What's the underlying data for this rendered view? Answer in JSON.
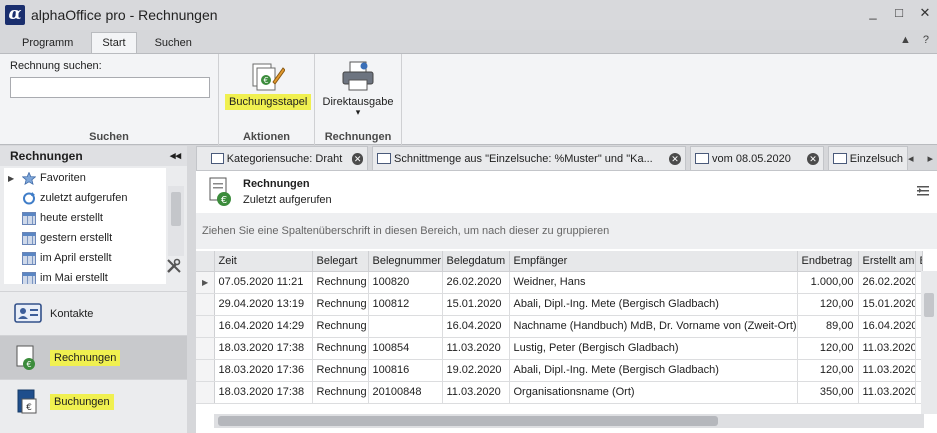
{
  "app": {
    "title": "alphaOffice pro - Rechnungen",
    "logo_glyph": "α",
    "controls": [
      "_",
      "□",
      "✕"
    ]
  },
  "ribbon_tabs": {
    "items": [
      "Programm",
      "Start",
      "Suchen"
    ],
    "active": "Start",
    "right_icons": [
      "▲",
      "?"
    ]
  },
  "ribbon": {
    "search": {
      "label": "Rechnung suchen:",
      "value": "",
      "placeholder": ""
    },
    "groups": {
      "suchen": "Suchen",
      "aktionen": "Aktionen",
      "rechnungen": "Rechnungen"
    },
    "buttons": {
      "buchungsstapel": "Buchungsstapel",
      "direktausgabe": "Direktausgabe",
      "direktausgabe_arrow": "▾"
    }
  },
  "left_panel": {
    "title": "Rechnungen",
    "collapse_glyph": "◂◂",
    "tree": [
      {
        "label": "Favoriten",
        "icon": "star-icon",
        "expander": "▶"
      },
      {
        "label": "zuletzt aufgerufen",
        "icon": "refresh-icon"
      },
      {
        "label": "heute erstellt",
        "icon": "grid-icon"
      },
      {
        "label": "gestern erstellt",
        "icon": "grid-icon"
      },
      {
        "label": "im April erstellt",
        "icon": "grid-icon"
      },
      {
        "label": "im Mai erstellt",
        "icon": "grid-icon"
      }
    ],
    "nav": [
      {
        "label": "Kontakte",
        "icon": "contacts-icon",
        "selected": false
      },
      {
        "label": "Rechnungen",
        "icon": "invoice-icon",
        "selected": true
      },
      {
        "label": "Buchungen",
        "icon": "booking-icon",
        "selected": false
      }
    ]
  },
  "doc_tabs": [
    {
      "label": "Kategoriensuche: Draht",
      "close": "✕"
    },
    {
      "label": "Schnittmenge aus \"Einzelsuche: %Muster\" und \"Ka...",
      "close": "✕"
    },
    {
      "label": "vom 08.05.2020",
      "close": "✕"
    },
    {
      "label": "Einzelsuch",
      "close": ""
    }
  ],
  "tab_arrows": [
    "◂",
    "▸"
  ],
  "content": {
    "title": "Rechnungen",
    "subtitle": "Zuletzt aufgerufen",
    "group_hint": "Ziehen Sie eine Spaltenüberschrift in diesen Bereich, um nach dieser zu gruppieren",
    "row_indicator": "▶",
    "columns": [
      "Zeit",
      "Belegart",
      "Belegnummer",
      "Belegdatum",
      "Empfänger",
      "Endbetrag",
      "Erstellt am",
      "B"
    ],
    "rows": [
      [
        "07.05.2020 11:21",
        "Rechnung",
        "100820",
        "26.02.2020",
        "Weidner, Hans",
        "1.000,00",
        "26.02.2020"
      ],
      [
        "29.04.2020 13:19",
        "Rechnung",
        "100812",
        "15.01.2020",
        "Abali, Dipl.-Ing. Mete (Bergisch Gladbach)",
        "120,00",
        "15.01.2020"
      ],
      [
        "16.04.2020 14:29",
        "Rechnung",
        "",
        "16.04.2020",
        "Nachname (Handbuch) MdB, Dr. Vorname von (Zweit-Ort)",
        "89,00",
        "16.04.2020"
      ],
      [
        "18.03.2020 17:38",
        "Rechnung",
        "100854",
        "11.03.2020",
        "Lustig, Peter (Bergisch Gladbach)",
        "120,00",
        "11.03.2020"
      ],
      [
        "18.03.2020 17:36",
        "Rechnung",
        "100816",
        "19.02.2020",
        "Abali, Dipl.-Ing. Mete (Bergisch Gladbach)",
        "120,00",
        "11.03.2020"
      ],
      [
        "18.03.2020 17:38",
        "Rechnung",
        "20100848",
        "11.03.2020",
        "Organisationsname (Ort)",
        "350,00",
        "11.03.2020"
      ]
    ]
  },
  "colors": {
    "highlight": "#f0f050",
    "accent_blue": "#1b2f6e"
  }
}
